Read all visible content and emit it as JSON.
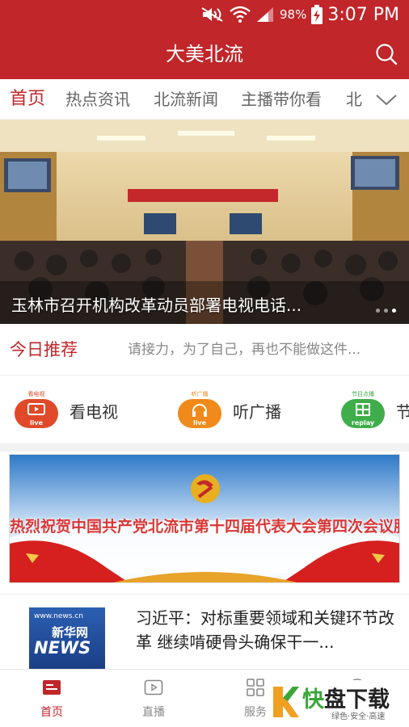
{
  "status_bar": {
    "battery_percent": "98%",
    "time": "3:07 PM"
  },
  "app_bar": {
    "title": "大美北流"
  },
  "tabs": [
    {
      "label": "首页",
      "active": true
    },
    {
      "label": "热点资讯",
      "active": false
    },
    {
      "label": "北流新闻",
      "active": false
    },
    {
      "label": "主播带你看",
      "active": false
    },
    {
      "label": "北",
      "active": false
    }
  ],
  "banner": {
    "caption": "玉林市召开机构改革动员部署电视电话...",
    "slides_total": 3,
    "active_slide": 3
  },
  "recommend": {
    "label": "今日推荐",
    "text": "请接力，为了自己，再也不能做这件..."
  },
  "quick_links": [
    {
      "tag": "看电视",
      "sub": "live",
      "label": "看电视",
      "color": "#e04a2a",
      "icon": "tv-icon"
    },
    {
      "tag": "听广播",
      "sub": "live",
      "label": "听广播",
      "color": "#f08a1a",
      "icon": "headphones-icon"
    },
    {
      "tag": "节目点播",
      "sub": "replay",
      "label": "节",
      "color": "#3fae4a",
      "icon": "replay-icon"
    }
  ],
  "ad_banner": {
    "text": "热烈祝贺中国共产党北流市第十四届代表大会第四次会议胜利召开"
  },
  "news": [
    {
      "title": "习近平：对标重要领域和关键环节改革 继续啃硬骨头确保干一...",
      "thumb_url": "www.news.cn",
      "thumb_name": "新华网",
      "thumb_big": "NEWS"
    }
  ],
  "tab_bar": [
    {
      "label": "首页",
      "active": true,
      "icon": "home-icon"
    },
    {
      "label": "直播",
      "active": false,
      "icon": "play-icon"
    },
    {
      "label": "服务",
      "active": false,
      "icon": "grid-icon"
    },
    {
      "label": "",
      "active": false,
      "icon": "user-icon"
    }
  ],
  "watermark": {
    "brand_green": "快",
    "brand_dark": "盘下载",
    "slogan": "绿色·安全·高速"
  },
  "colors": {
    "primary": "#c0262a",
    "text_muted": "#888888"
  }
}
